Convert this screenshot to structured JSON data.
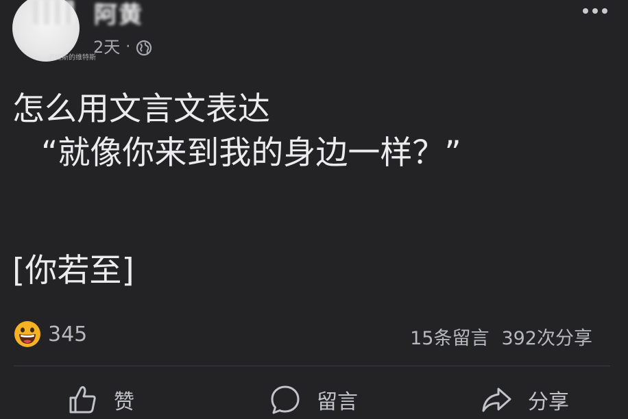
{
  "header": {
    "username": "阿黄",
    "watermark": "老挝斯的维特斯",
    "time": "2天",
    "separator": "·",
    "visibility_icon": "globe-icon",
    "more_icon": "more-dots-icon"
  },
  "post": {
    "line1": "怎么用文言文表达",
    "line2": "“就像你来到我的身边一样？”",
    "line3": "[你若至]"
  },
  "stats": {
    "reaction_icon": "grinning-emoji-icon",
    "reaction_count": "345",
    "comments": "15条留言",
    "shares": "392次分享"
  },
  "actions": {
    "like_label": "赞",
    "comment_label": "留言",
    "share_label": "分享",
    "like_icon": "thumbs-up-icon",
    "comment_icon": "comment-bubble-icon",
    "share_icon": "share-arrow-icon"
  },
  "colors": {
    "background": "#232326",
    "text": "#ececef",
    "secondary_text": "#b8b9be",
    "emoji_yellow": "#f7b125"
  }
}
